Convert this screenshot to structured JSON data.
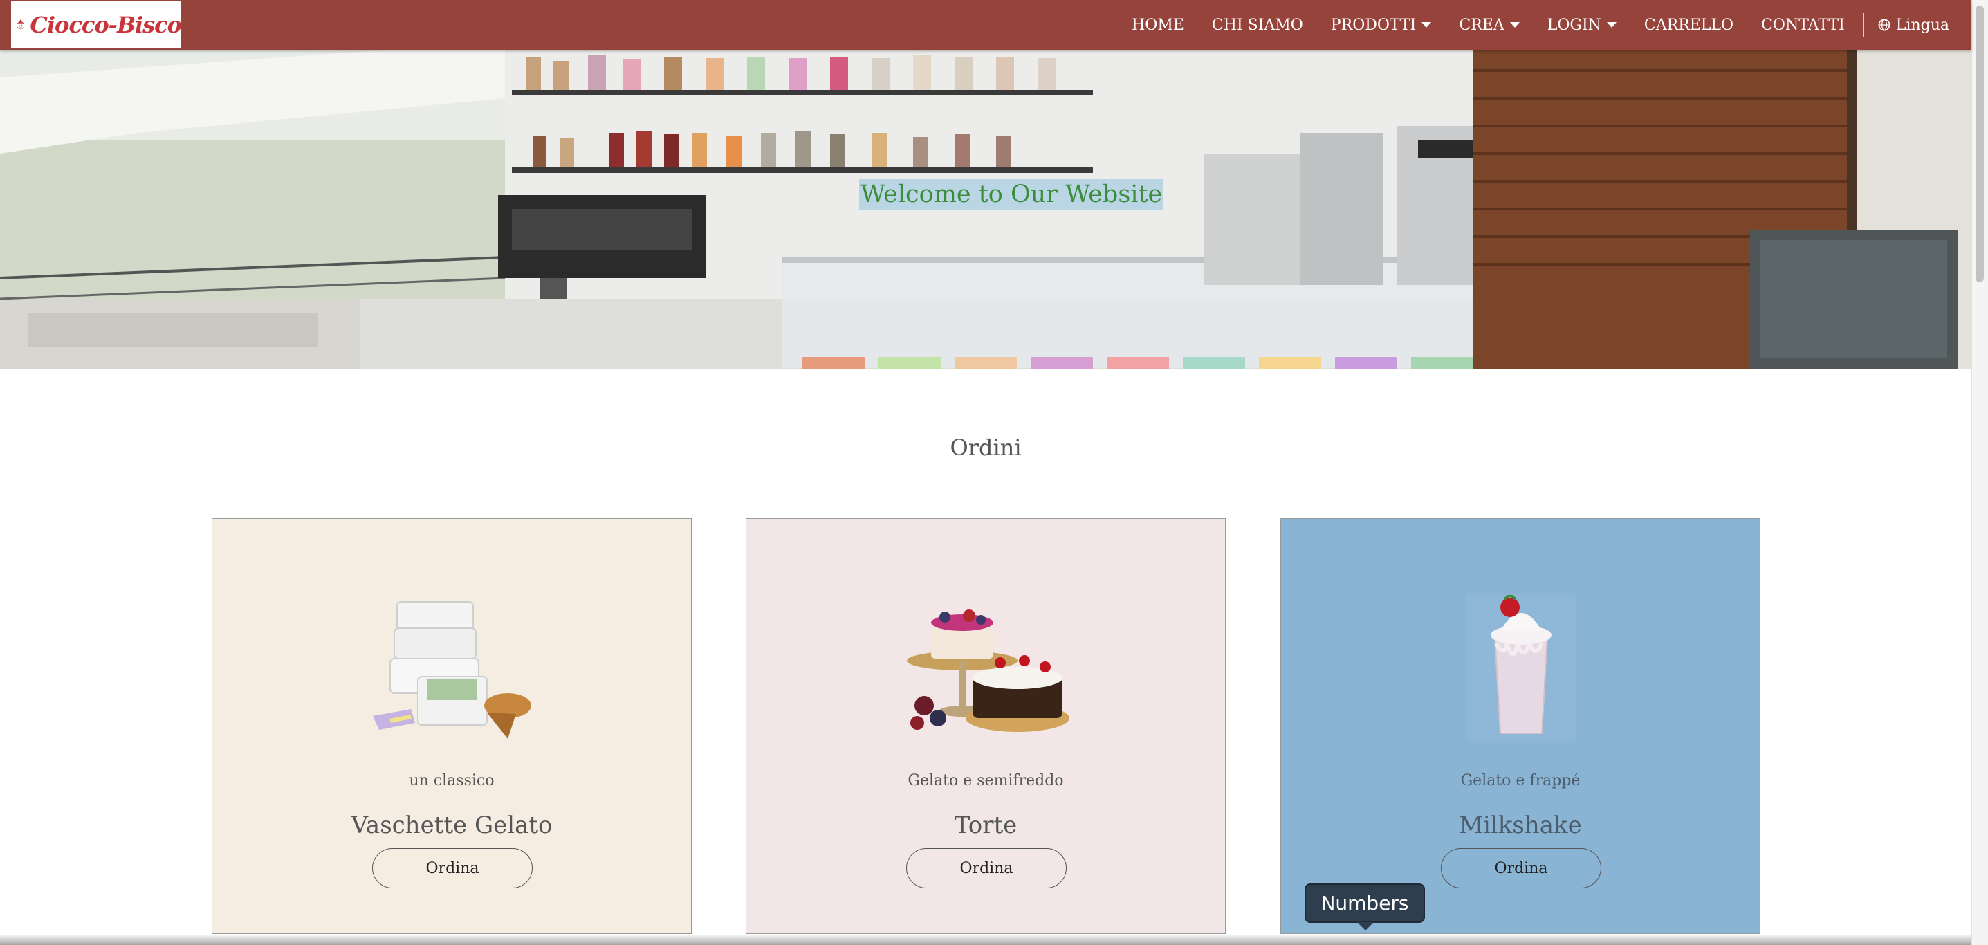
{
  "brand": {
    "name": "Ciocco-Bisco",
    "logo_icon": "ice-cream-mascot-icon"
  },
  "nav": {
    "items": [
      {
        "label": "HOME",
        "dropdown": false
      },
      {
        "label": "CHI SIAMO",
        "dropdown": false
      },
      {
        "label": "PRODOTTI",
        "dropdown": true
      },
      {
        "label": "CREA",
        "dropdown": true
      },
      {
        "label": "LOGIN",
        "dropdown": true
      },
      {
        "label": "CARRELLO",
        "dropdown": false
      },
      {
        "label": "CONTATTI",
        "dropdown": false
      }
    ],
    "language_label": "Lingua",
    "language_icon": "globe-icon"
  },
  "hero": {
    "title": "Welcome to Our Website"
  },
  "section": {
    "title": "Ordini"
  },
  "cards": [
    {
      "subtitle": "un classico",
      "title": "Vaschette Gelato",
      "button": "Ordina",
      "image": "ice-cream-tubs-image",
      "bg": "#f5ede1"
    },
    {
      "subtitle": "Gelato e semifreddo",
      "title": "Torte",
      "button": "Ordina",
      "image": "cakes-image",
      "bg": "#f2e6e6"
    },
    {
      "subtitle": "Gelato e frappé",
      "title": "Milkshake",
      "button": "Ordina",
      "image": "milkshake-image",
      "bg": "#8ab4d4"
    }
  ],
  "tooltip": {
    "text": "Numbers"
  },
  "colors": {
    "navbar": "#96433c",
    "hero_title": "#3b8c3b",
    "brand_red": "#c8353b"
  }
}
